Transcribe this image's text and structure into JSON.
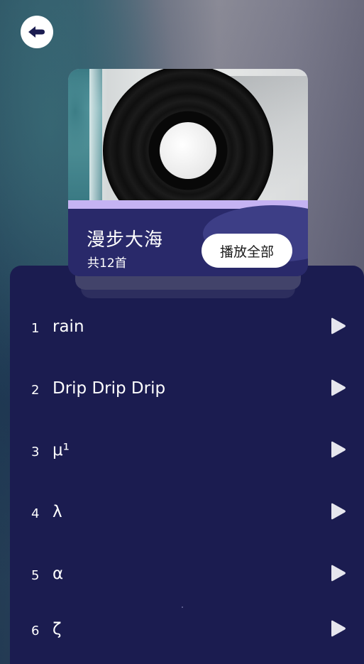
{
  "header": {
    "back_icon": "back-arrow-icon"
  },
  "album": {
    "title": "漫步大海",
    "count": "共12首",
    "play_all_label": "播放全部",
    "cover_icon": "vinyl-record-icon"
  },
  "tracks": [
    {
      "num": "1",
      "name": "rain",
      "icon": "play-icon"
    },
    {
      "num": "2",
      "name": "Drip Drip Drip",
      "icon": "play-icon"
    },
    {
      "num": "3",
      "name": "μ¹",
      "icon": "play-icon"
    },
    {
      "num": "4",
      "name": "λ",
      "icon": "play-icon"
    },
    {
      "num": "5",
      "name": "α",
      "icon": "play-icon"
    },
    {
      "num": "6",
      "name": "ζ",
      "icon": "play-icon"
    }
  ],
  "colors": {
    "panel": "#1b1c50",
    "card_bottom": "#29296a",
    "accent_strip": "#c5b3f3",
    "text": "#ffffff"
  }
}
